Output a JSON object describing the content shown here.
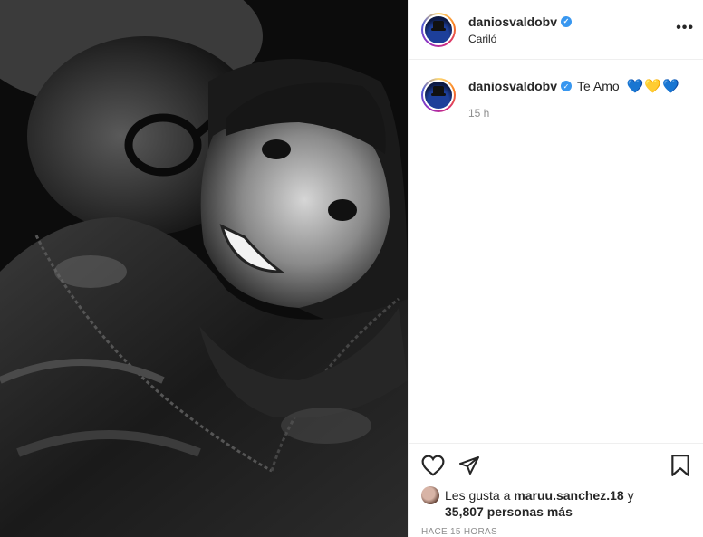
{
  "post": {
    "username": "daniosvaldobv",
    "location": "Cariló",
    "more_label": "•••"
  },
  "caption": {
    "username": "daniosvaldobv",
    "text": "Te Amo",
    "hearts": [
      "💙",
      "💛",
      "💙"
    ],
    "time": "15 h"
  },
  "likes": {
    "prefix": "Les gusta a",
    "user": "maruu.sanchez.18",
    "joiner": "y",
    "count": "35,807",
    "suffix": "personas más"
  },
  "timestamp": "HACE 15 HORAS",
  "colors": {
    "verified": "#3897f0",
    "muted": "#8e8e8e",
    "text": "#262626",
    "border": "#efefef"
  },
  "icons": {
    "like": "heart-outline-icon",
    "share": "paper-plane-icon",
    "save": "bookmark-icon",
    "more": "more-dots-icon",
    "verified": "verified-badge-icon"
  }
}
